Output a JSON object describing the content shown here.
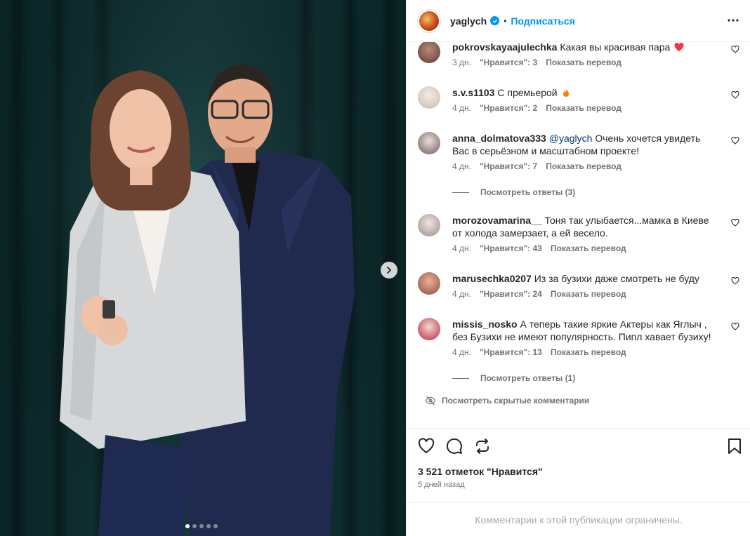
{
  "post": {
    "author": "yaglych",
    "follow_label": "Подписаться",
    "separator": "•",
    "likes": "3 521 отметок \"Нравится\"",
    "date": "5 дней назад",
    "comments_limited": "Комментарии к этой публикации ограничены."
  },
  "carousel": {
    "slides": 5,
    "current": 1
  },
  "comments": [
    {
      "user": "pokrovskayaajulechka",
      "text": "Какая вы красивая пара",
      "emoji": "heart",
      "age": "3 дн.",
      "likes": "\"Нравится\": 3",
      "translate": "Показать перевод"
    },
    {
      "user": "s.v.s1103",
      "text": "С премьерой",
      "emoji": "fire",
      "age": "4 дн.",
      "likes": "\"Нравится\": 2",
      "translate": "Показать перевод"
    },
    {
      "user": "anna_dolmatova333",
      "mention": "@yaglych",
      "text": "Очень хочется увидеть Вас в серьёзном и масштабном проекте!",
      "age": "4 дн.",
      "likes": "\"Нравится\": 7",
      "translate": "Показать перевод",
      "replies": "Посмотреть ответы (3)"
    },
    {
      "user": "morozovamarina__",
      "text": "Тоня так улыбается...мамка в Киеве от холода замерзает, а ей весело.",
      "age": "4 дн.",
      "likes": "\"Нравится\": 43",
      "translate": "Показать перевод"
    },
    {
      "user": "marusechka0207",
      "text": "Из за бузихи даже смотреть не буду",
      "age": "4 дн.",
      "likes": "\"Нравится\": 24",
      "translate": "Показать перевод"
    },
    {
      "user": "missis_nosko",
      "text": "А теперь такие яркие Актеры как Яглыч , без Бузихи не имеют популярность. Пипл хавает бузиху!",
      "age": "4 дн.",
      "likes": "\"Нравится\": 13",
      "translate": "Показать перевод",
      "replies": "Посмотреть ответы (1)"
    }
  ],
  "hidden_comments": "Посмотреть скрытые комментарии",
  "colors": {
    "accent": "#0095f6",
    "heart": "#ff3040",
    "fire": "#ff7a00",
    "curtain": "#0f2f31"
  },
  "icons": [
    "verified-badge-icon",
    "more-options-icon",
    "like-icon",
    "comment-icon",
    "repost-icon",
    "save-icon",
    "chevron-right-icon",
    "eye-off-icon"
  ]
}
